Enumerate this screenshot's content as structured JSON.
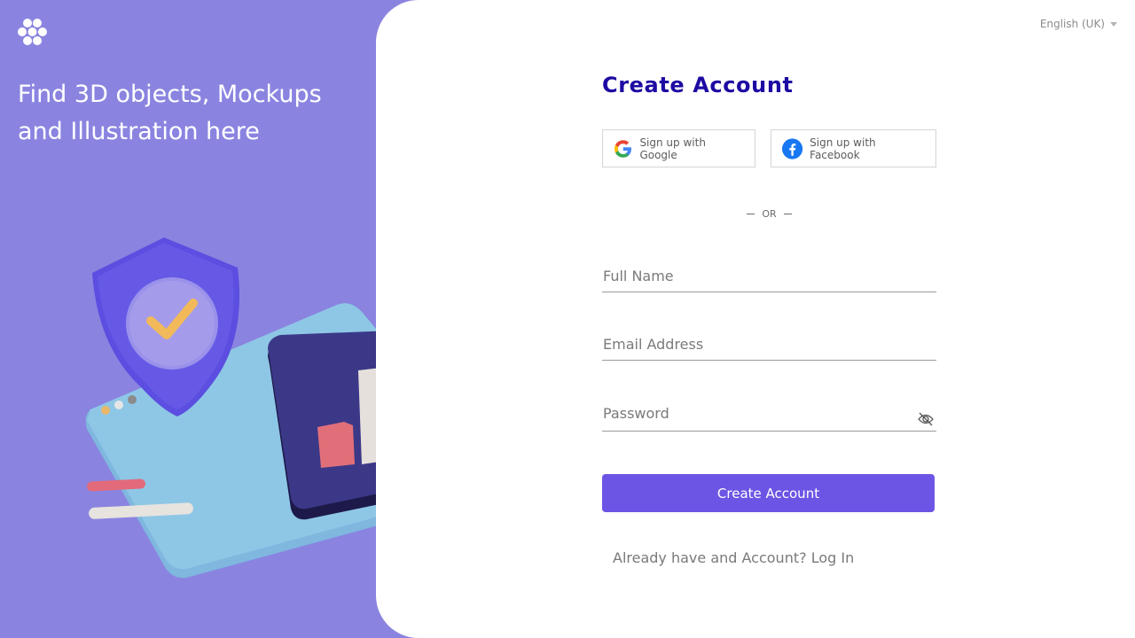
{
  "brand": {
    "logo_icon": "honeycomb-logo-icon",
    "tagline": "Find 3D objects, Mockups and Illustration here"
  },
  "colors": {
    "left_bg": "#8a84e0",
    "title": "#1d0aa3",
    "primary": "#6c55e4"
  },
  "language": {
    "label": "English (UK)",
    "icon": "chevron-down-icon"
  },
  "form": {
    "title": "Create Account",
    "google_label": "Sign up with Google",
    "facebook_label": "Sign up with Facebook",
    "or_label": "OR",
    "full_name_placeholder": "Full Name",
    "email_placeholder": "Email Address",
    "password_placeholder": "Password",
    "password_toggle_icon": "eye-slash-icon",
    "submit_label": "Create Account",
    "login_prompt": "Already have and Account? Log In"
  }
}
